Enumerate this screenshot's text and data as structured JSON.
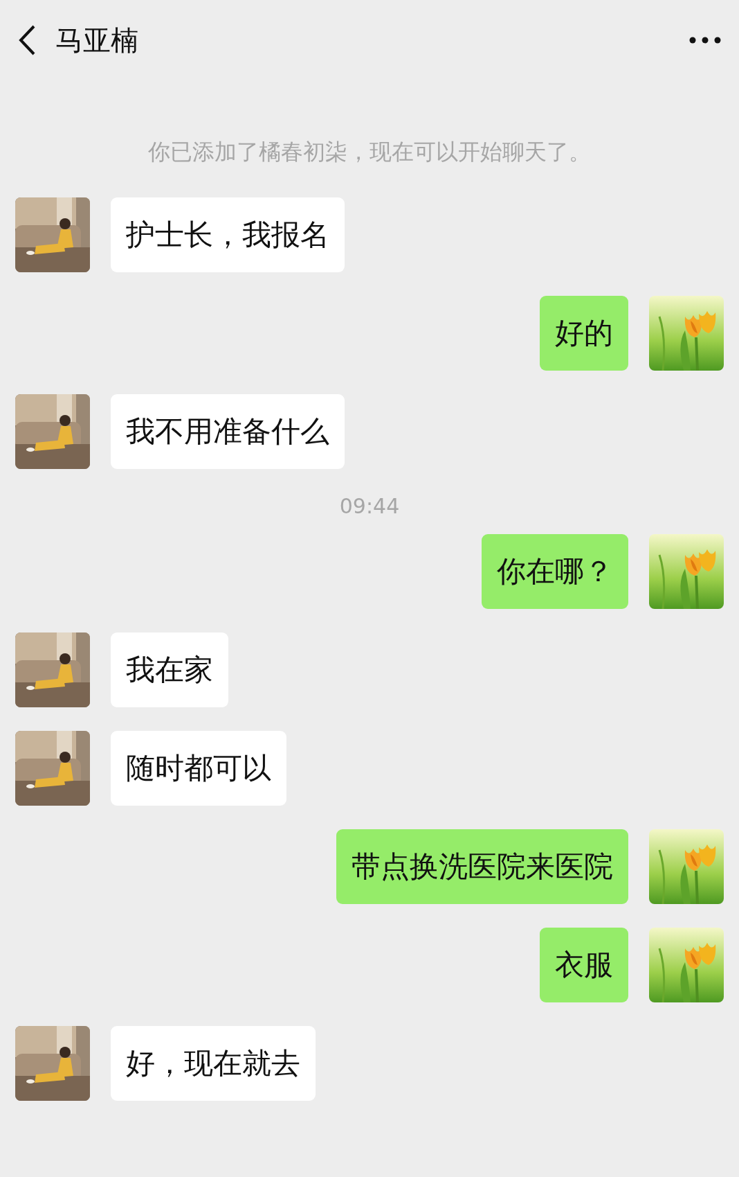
{
  "header": {
    "title": "马亚楠"
  },
  "messages": [
    {
      "kind": "system",
      "text": "你已添加了橘春初柒，现在可以开始聊天了。"
    },
    {
      "kind": "received",
      "text": "护士长，我报名"
    },
    {
      "kind": "sent",
      "text": "好的"
    },
    {
      "kind": "received",
      "text": "我不用准备什么"
    },
    {
      "kind": "time",
      "text": "09:44"
    },
    {
      "kind": "sent",
      "text": "你在哪？"
    },
    {
      "kind": "received",
      "text": "我在家"
    },
    {
      "kind": "received",
      "text": "随时都可以"
    },
    {
      "kind": "sent",
      "text": "带点换洗医院来医院"
    },
    {
      "kind": "sent",
      "text": "衣服"
    },
    {
      "kind": "received",
      "text": "好，现在就去"
    }
  ]
}
